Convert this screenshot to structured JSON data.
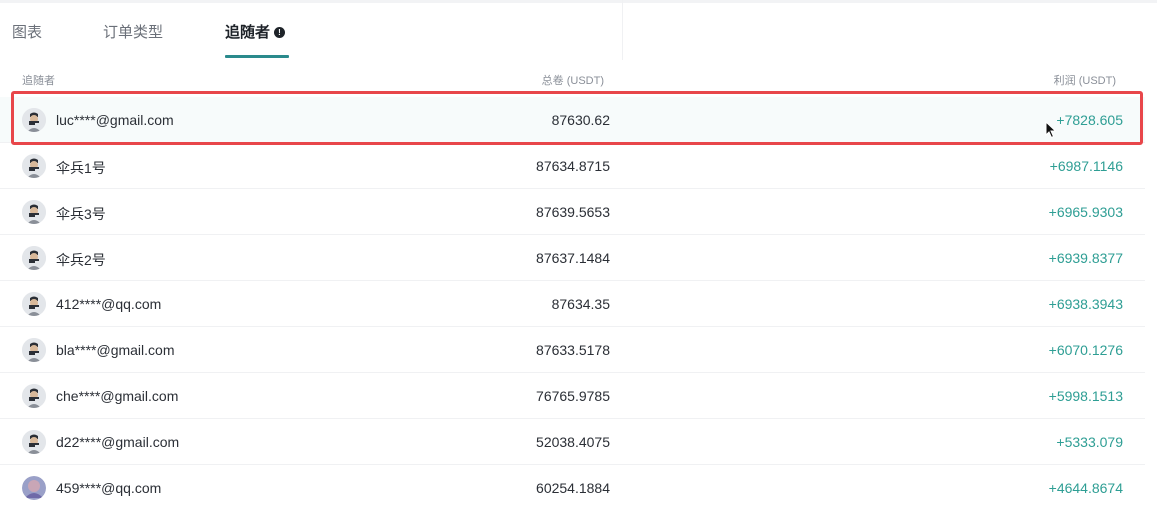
{
  "tabs": [
    {
      "label": "图表"
    },
    {
      "label": "订单类型"
    },
    {
      "label": "追随者",
      "active": true,
      "info_icon": "info-icon"
    }
  ],
  "table": {
    "headers": {
      "name": "追随者",
      "volume": "总卷 (USDT)",
      "profit": "利润 (USDT)"
    },
    "rows": [
      {
        "name": "luc****@gmail.com",
        "volume": "87630.62",
        "profit": "+7828.605",
        "avatar": "user-avatar-icon"
      },
      {
        "name": "伞兵1号",
        "volume": "87634.8715",
        "profit": "+6987.1146",
        "avatar": "user-avatar-icon"
      },
      {
        "name": "伞兵3号",
        "volume": "87639.5653",
        "profit": "+6965.9303",
        "avatar": "user-avatar-icon"
      },
      {
        "name": "伞兵2号",
        "volume": "87637.1484",
        "profit": "+6939.8377",
        "avatar": "user-avatar-icon"
      },
      {
        "name": "412****@qq.com",
        "volume": "87634.35",
        "profit": "+6938.3943",
        "avatar": "user-avatar-icon"
      },
      {
        "name": "bla****@gmail.com",
        "volume": "87633.5178",
        "profit": "+6070.1276",
        "avatar": "user-avatar-icon"
      },
      {
        "name": "che****@gmail.com",
        "volume": "76765.9785",
        "profit": "+5998.1513",
        "avatar": "user-avatar-icon"
      },
      {
        "name": "d22****@gmail.com",
        "volume": "52038.4075",
        "profit": "+5333.079",
        "avatar": "user-avatar-icon"
      },
      {
        "name": "459****@qq.com",
        "volume": "60254.1884",
        "profit": "+4644.8674",
        "avatar": "user-avatar-photo-icon"
      }
    ]
  },
  "colors": {
    "profit": "#2e9e94",
    "accent": "#2a8a8c",
    "highlight": "#e8464a"
  }
}
